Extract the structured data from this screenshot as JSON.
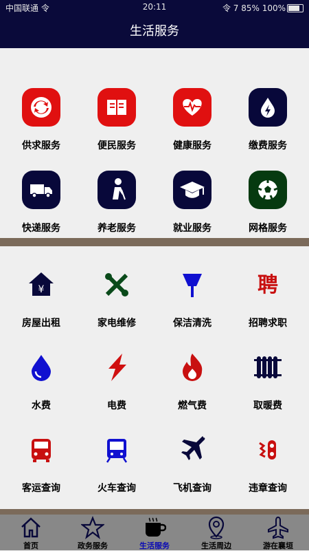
{
  "status": {
    "left": "中国联通 令",
    "time": "20:11",
    "right": "令 7 85% 100%"
  },
  "header": {
    "title": "生活服务"
  },
  "section1": [
    {
      "label": "供求服务",
      "icon": "swap-arrows-icon",
      "color": "#e01010"
    },
    {
      "label": "便民服务",
      "icon": "book-icon",
      "color": "#e01010"
    },
    {
      "label": "健康服务",
      "icon": "heartbeat-icon",
      "color": "#e01010"
    },
    {
      "label": "缴费服务",
      "icon": "lightning-drop-icon",
      "color": "#08083a"
    },
    {
      "label": "快递服务",
      "icon": "truck-icon",
      "color": "#08083a"
    },
    {
      "label": "养老服务",
      "icon": "elderly-icon",
      "color": "#08083a"
    },
    {
      "label": "就业服务",
      "icon": "graduation-cap-icon",
      "color": "#08083a"
    },
    {
      "label": "网格服务",
      "icon": "grid-ball-icon",
      "color": "#063a10"
    }
  ],
  "section2": [
    {
      "label": "房屋出租",
      "icon": "house-yen-icon"
    },
    {
      "label": "家电维修",
      "icon": "tools-icon"
    },
    {
      "label": "保洁清洗",
      "icon": "broom-icon"
    },
    {
      "label": "招聘求职",
      "icon": "recruit-char-icon"
    },
    {
      "label": "水费",
      "icon": "water-drop-icon"
    },
    {
      "label": "电费",
      "icon": "lightning-icon"
    },
    {
      "label": "燃气费",
      "icon": "flame-icon"
    },
    {
      "label": "取暖费",
      "icon": "radiator-icon"
    },
    {
      "label": "客运查询",
      "icon": "bus-icon"
    },
    {
      "label": "火车查询",
      "icon": "train-icon"
    },
    {
      "label": "飞机查询",
      "icon": "airplane-icon"
    },
    {
      "label": "违章查询",
      "icon": "violation-icon"
    }
  ],
  "tabs": [
    {
      "label": "首页",
      "icon": "home-icon"
    },
    {
      "label": "政务服务",
      "icon": "star-icon"
    },
    {
      "label": "生活服务",
      "icon": "coffee-cup-icon",
      "active": true
    },
    {
      "label": "生活周边",
      "icon": "location-pin-icon"
    },
    {
      "label": "游在襄垣",
      "icon": "airplane-icon"
    }
  ],
  "colors": {
    "header": "#0a0a3a",
    "divider": "#7b6a5a",
    "tabbar": "#888888",
    "active_tab": "#0a0ab4"
  }
}
